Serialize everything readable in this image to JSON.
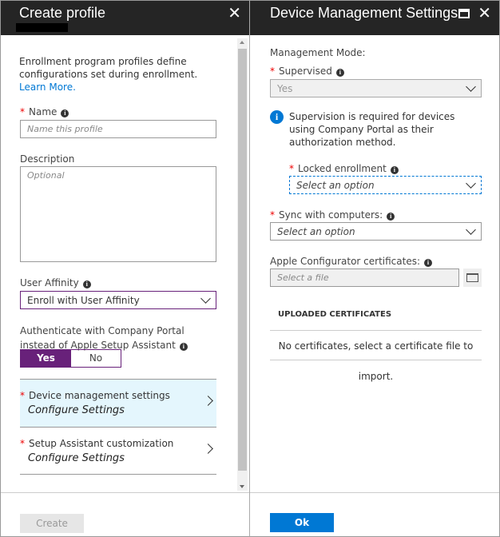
{
  "left": {
    "title": "Create profile",
    "intro": "Enrollment program profiles define configurations set during enrollment.",
    "learn_more": "Learn More.",
    "name_label": "Name",
    "name_placeholder": "Name this profile",
    "description_label": "Description",
    "description_placeholder": "Optional",
    "user_affinity_label": "User Affinity",
    "user_affinity_value": "Enroll with User Affinity",
    "auth_label": "Authenticate with Company Portal instead of Apple Setup Assistant",
    "toggle_yes": "Yes",
    "toggle_no": "No",
    "toggle_selected": "Yes",
    "nav": [
      {
        "label": "Device management settings",
        "sub": "Configure Settings",
        "selected": true
      },
      {
        "label": "Setup Assistant customization",
        "sub": "Configure Settings",
        "selected": false
      }
    ],
    "create_button": "Create"
  },
  "right": {
    "title": "Device Management Settings",
    "mode_label": "Management Mode:",
    "supervised_label": "Supervised",
    "supervised_value": "Yes",
    "info_text": "Supervision is required for devices using Company Portal as their authorization method.",
    "locked_label": "Locked enrollment",
    "locked_value": "Select an option",
    "sync_label": "Sync with computers:",
    "sync_value": "Select an option",
    "cert_label": "Apple Configurator certificates:",
    "cert_placeholder": "Select a file",
    "uploaded_header": "UPLOADED CERTIFICATES",
    "no_certs": "No certificates, select a certificate file to import.",
    "ok_button": "Ok"
  },
  "colors": {
    "accent": "#68217a",
    "primary": "#0078d4",
    "selected_bg": "#e4f6fd",
    "header": "#252525"
  }
}
